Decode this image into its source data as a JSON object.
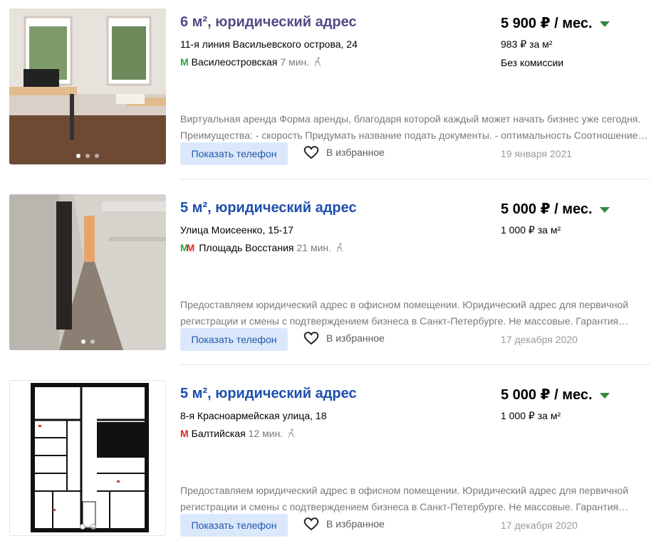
{
  "colors": {
    "link": "#1d4fae",
    "visited_link": "#524b85",
    "phone_button_bg": "#dbe8fb",
    "price_arrow": "#2c8a3a",
    "metro_green": "#27a844",
    "metro_red": "#d8292c"
  },
  "listings": [
    {
      "title": "6 м², юридический адрес",
      "address": "11-я линия Васильевского острова, 24",
      "metro_icon": "metro-green-icon",
      "metro_station": "Василеостровская",
      "metro_time": "7 мин.",
      "price": "5 900 ₽ / мес.",
      "price_per_m": "983 ₽ за м²",
      "commission": "Без комиссии",
      "description": [
        "Виртуальная аренда Форма аренды, благодаря которой каждый может начать бизнес уже сегодня.",
        "Преимущества: - скорость Придумать название подать документы. - оптимальность Соотношение…"
      ],
      "phone_button": "Показать телефон",
      "favorite_label": "В избранное",
      "date": "19 января 2021"
    },
    {
      "title": "5 м², юридический адрес",
      "address": "Улица Моисеенко, 15-17",
      "metro_icon": "metro-green-red-icon",
      "metro_station": "Площадь Восстания",
      "metro_time": "21 мин.",
      "price": "5 000 ₽ / мес.",
      "price_per_m": "1 000 ₽ за м²",
      "commission": "",
      "description": [
        "Предоставляем юридический адрес в офисном помещении. Юридический адрес для первичной",
        "регистрации и смены с подтверждением бизнеса в Санкт-Петербурге. Не массовые. Гарантия…"
      ],
      "phone_button": "Показать телефон",
      "favorite_label": "В избранное",
      "date": "17 декабря 2020"
    },
    {
      "title": "5 м², юридический адрес",
      "address": "8-я Красноармейская улица, 18",
      "metro_icon": "metro-red-icon",
      "metro_station": "Балтийская",
      "metro_time": "12 мин.",
      "price": "5 000 ₽ / мес.",
      "price_per_m": "1 000 ₽ за м²",
      "commission": "",
      "description": [
        "Предоставляем юридический адрес в офисном помещении. Юридический адрес для первичной",
        "регистрации и смены с подтверждением бизнеса в Санкт-Петербурге. Не массовые. Гарантия…"
      ],
      "phone_button": "Показать телефон",
      "favorite_label": "В избранное",
      "date": "17 декабря 2020"
    }
  ]
}
